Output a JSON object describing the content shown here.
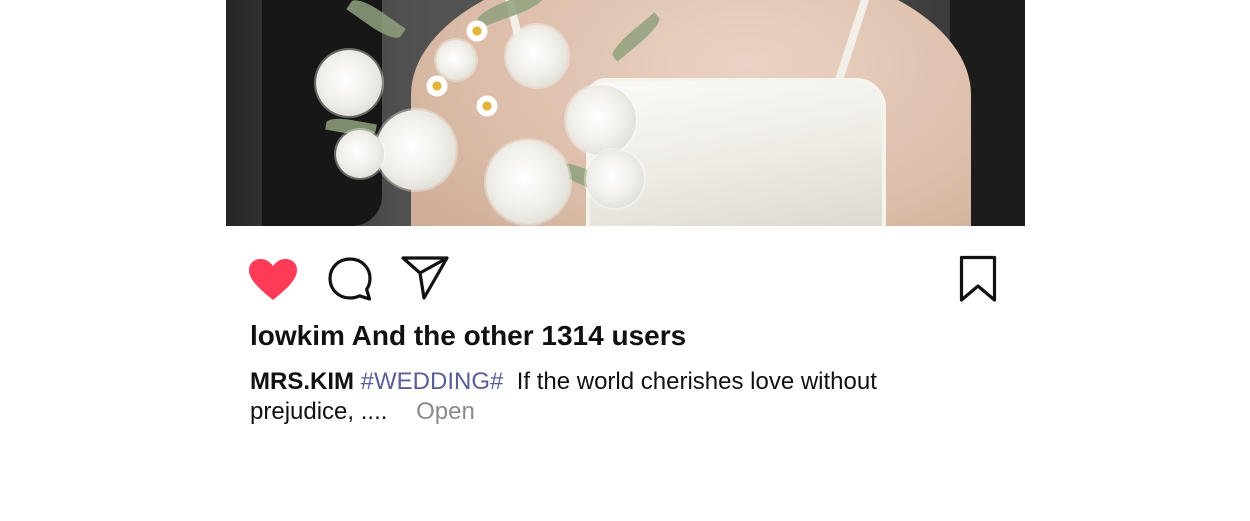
{
  "post": {
    "photo_alt": "Bride in white satin dress holding bouquet of white roses",
    "likes_text": "lowkim And the other 1314 users",
    "caption": {
      "username": "MRS.KIM",
      "hashtag": "#WEDDING#",
      "text": "If the world cherishes love without prejudice, ....",
      "open_label": "Open"
    },
    "icons": {
      "like": "heart-icon",
      "comment": "comment-icon",
      "share": "paper-plane-icon",
      "save": "bookmark-icon"
    },
    "colors": {
      "like_active": "#ff3b57",
      "hashtag": "#5b5d99",
      "open_link": "#8a8a8a",
      "text": "#111111"
    }
  }
}
